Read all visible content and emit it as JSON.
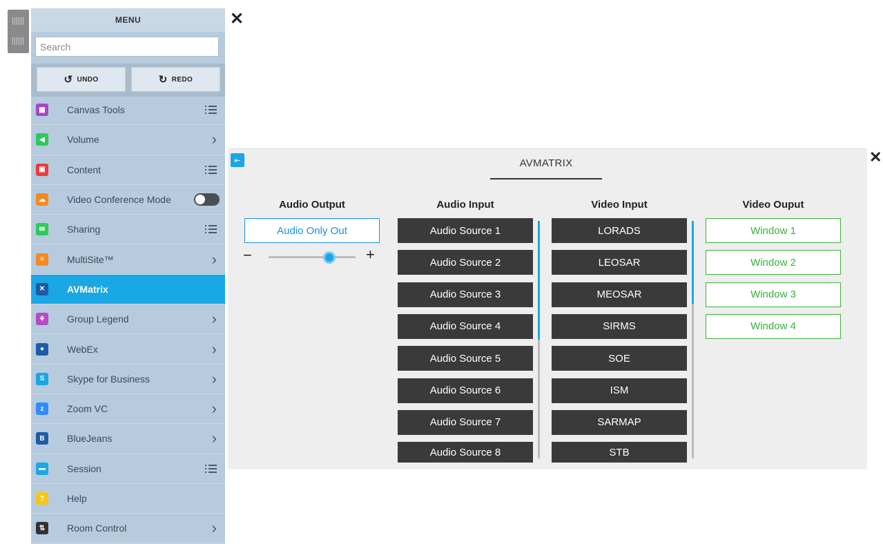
{
  "menu": {
    "title": "MENU",
    "search_placeholder": "Search",
    "undo_label": "UNDO",
    "redo_label": "REDO",
    "items": [
      {
        "label": "Canvas Tools",
        "color": "#a546c8",
        "icon": "canvas-tools-icon",
        "trail": "list"
      },
      {
        "label": "Volume",
        "color": "#2ec95b",
        "icon": "volume-icon",
        "trail": "chevron"
      },
      {
        "label": "Content",
        "color": "#ec3b3b",
        "icon": "content-icon",
        "trail": "list"
      },
      {
        "label": "Video Conference Mode",
        "color": "#f58a1f",
        "icon": "video-conference-icon",
        "trail": "toggle"
      },
      {
        "label": "Sharing",
        "color": "#2ec95b",
        "icon": "sharing-icon",
        "trail": "list"
      },
      {
        "label": "MultiSite™",
        "color": "#f58a1f",
        "icon": "multisite-icon",
        "trail": "chevron"
      },
      {
        "label": "AVMatrix",
        "color": "#1e5aa8",
        "icon": "avmatrix-icon",
        "trail": "none",
        "active": true
      },
      {
        "label": "Group Legend",
        "color": "#b44cc6",
        "icon": "group-legend-icon",
        "trail": "chevron"
      },
      {
        "label": "WebEx",
        "color": "#1e5aa8",
        "icon": "webex-icon",
        "trail": "chevron"
      },
      {
        "label": "Skype for Business",
        "color": "#1aa7e6",
        "icon": "skype-icon",
        "trail": "chevron"
      },
      {
        "label": "Zoom VC",
        "color": "#2d8cff",
        "icon": "zoom-icon",
        "trail": "chevron"
      },
      {
        "label": "BlueJeans",
        "color": "#1e5aa8",
        "icon": "bluejeans-icon",
        "trail": "chevron"
      },
      {
        "label": "Session",
        "color": "#1aa7e6",
        "icon": "session-folder-icon",
        "trail": "list"
      },
      {
        "label": "Help",
        "color": "#f5c518",
        "icon": "help-icon",
        "trail": "none"
      },
      {
        "label": "Room Control",
        "color": "#333333",
        "icon": "room-control-icon",
        "trail": "chevron"
      }
    ],
    "video_conference_mode_on": false
  },
  "av": {
    "title": "AVMATRIX",
    "columns": {
      "audio_output": "Audio Output",
      "audio_input": "Audio Input",
      "video_input": "Video Input",
      "video_output": "Video Ouput"
    },
    "audio_output_value": "Audio Only Out",
    "volume_level": 0.66,
    "audio_sources": [
      "Audio Source 1",
      "Audio Source 2",
      "Audio Source 3",
      "Audio Source 4",
      "Audio Source 5",
      "Audio Source 6",
      "Audio Source 7",
      "Audio Source 8"
    ],
    "video_inputs": [
      "LORADS",
      "LEOSAR",
      "MEOSAR",
      "SIRMS",
      "SOE",
      "ISM",
      "SARMAP",
      "STB"
    ],
    "video_outputs": [
      "Window 1",
      "Window 2",
      "Window 3",
      "Window 4"
    ],
    "accent_color": "#1aa7e6",
    "output_color": "#3ab13a"
  }
}
